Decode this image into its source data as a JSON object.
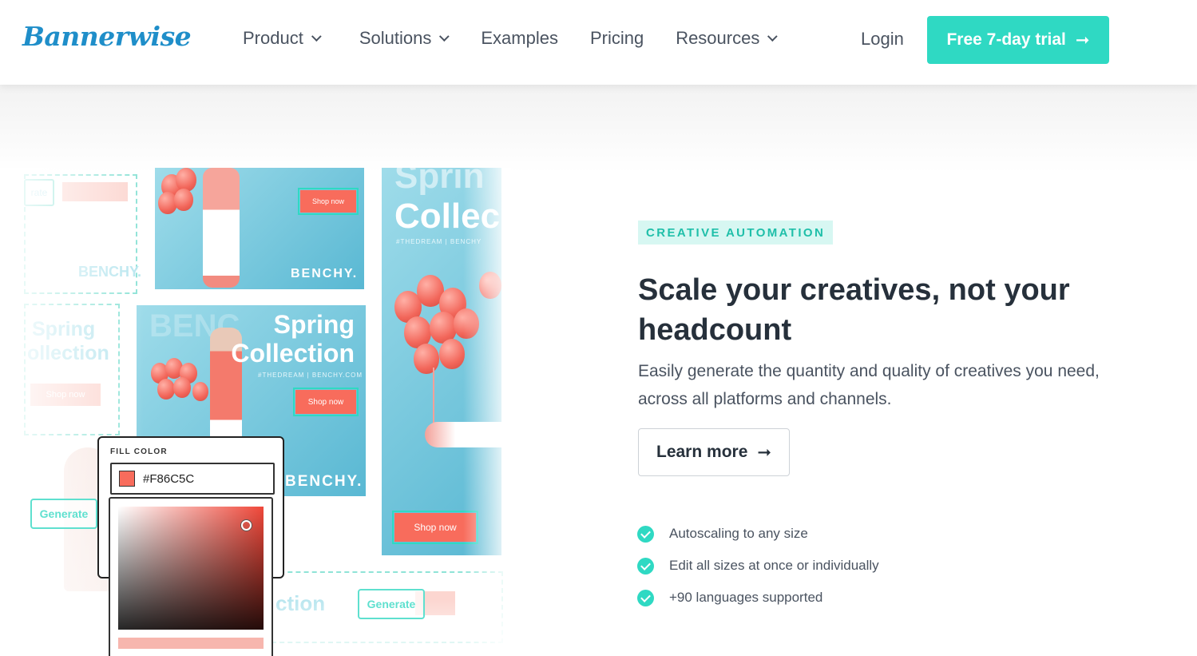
{
  "header": {
    "logo": "Bannerwise",
    "nav": [
      {
        "label": "Product",
        "has_dropdown": true
      },
      {
        "label": "Solutions",
        "has_dropdown": true
      },
      {
        "label": "Examples",
        "has_dropdown": false
      },
      {
        "label": "Pricing",
        "has_dropdown": false
      },
      {
        "label": "Resources",
        "has_dropdown": true
      }
    ],
    "login": "Login",
    "cta": "Free 7-day trial",
    "cta_icon": "arrow-right-icon"
  },
  "collage": {
    "ghost_brand": "BENCHY.",
    "ghost_title_1": "Spring",
    "ghost_title_2": "ollection",
    "ghost_shop": "Shop now",
    "ghost_partial": "rate",
    "ghost_bottom": "ction",
    "banner_small": {
      "shop": "Shop now",
      "brand": "BENCHY."
    },
    "banner_medium": {
      "title_1": "Spring",
      "title_2": "Collection",
      "tag": "#THEDREAM | BENCHY.COM",
      "shop": "Shop now",
      "brand": "BENCHY.",
      "ghost": "BENC"
    },
    "banner_tall": {
      "title_1": "Sprin",
      "title_2": "Collec",
      "tag": "#THEDREAM | BENCHY",
      "shop": "Shop now"
    },
    "generate": "Generate",
    "fill": {
      "label": "FILL COLOR",
      "hex": "#F86C5C"
    }
  },
  "hero": {
    "eyebrow": "CREATIVE AUTOMATION",
    "headline": "Scale your creatives, not your headcount",
    "subtext": "Easily generate the quantity and quality of creatives you need, across all platforms and channels.",
    "learn_more": "Learn more",
    "features": [
      "Autoscaling to any size",
      "Edit all sizes at once or individually",
      "+90 languages supported"
    ]
  },
  "colors": {
    "accent": "#2fd9c3",
    "brand": "#1f8ec9",
    "coral": "#F86C5C",
    "text": "#26303b"
  }
}
